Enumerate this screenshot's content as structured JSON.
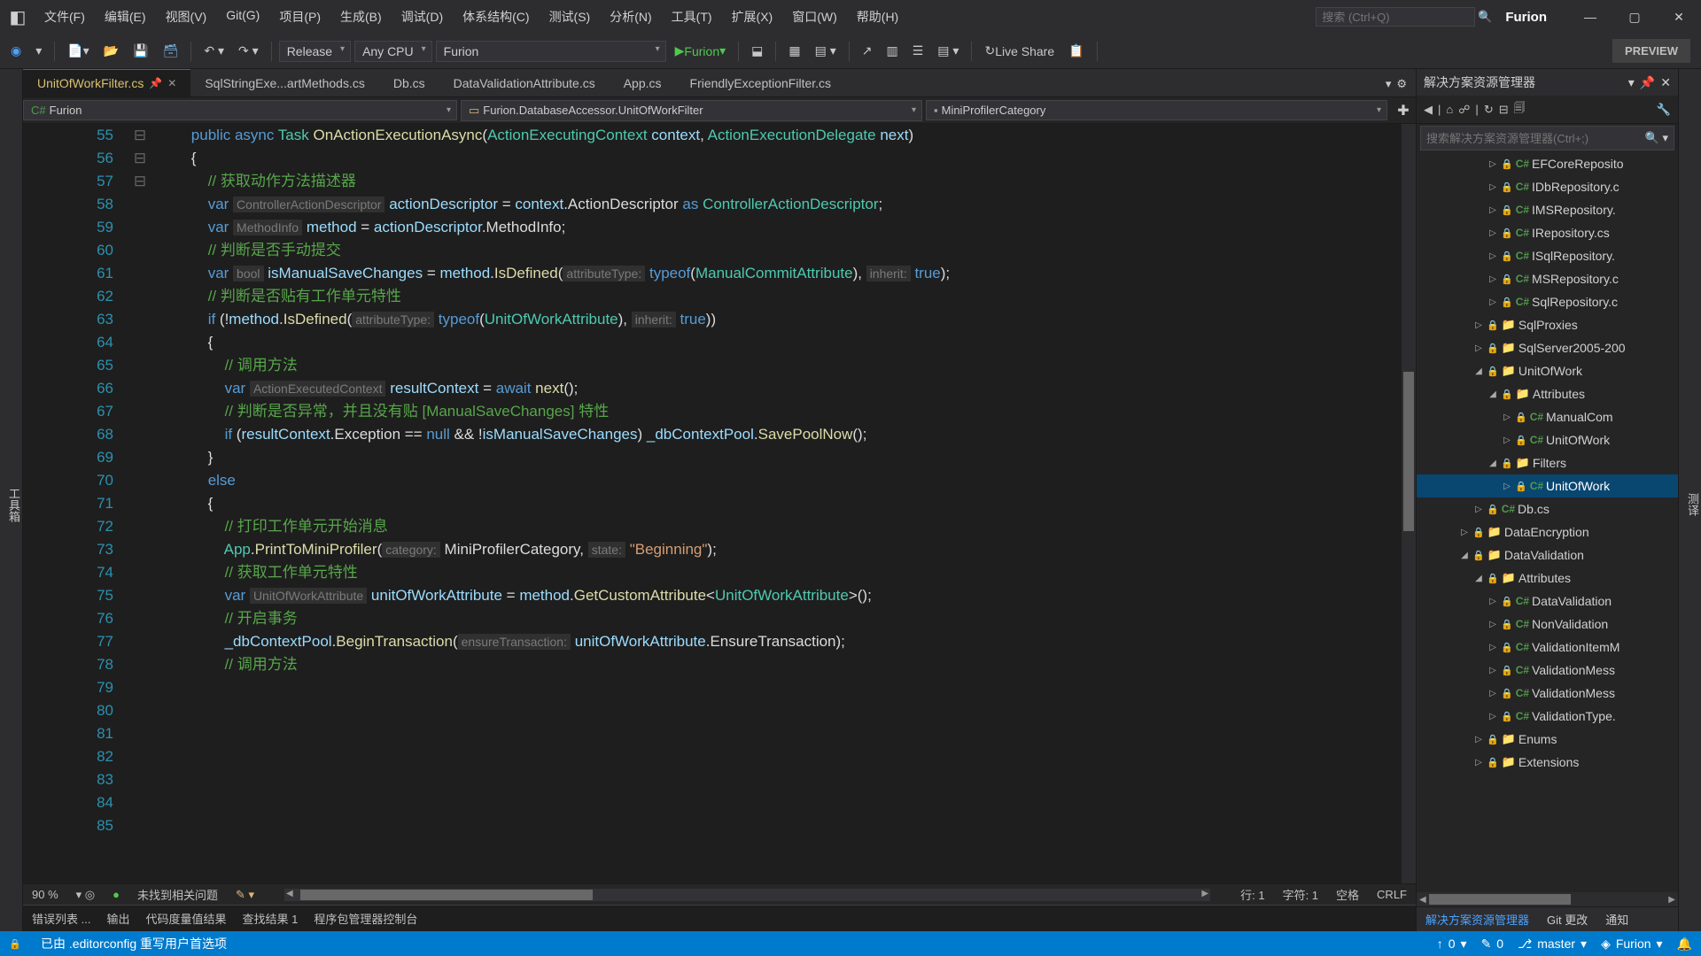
{
  "title": "Furion",
  "menu": [
    "文件(F)",
    "编辑(E)",
    "视图(V)",
    "Git(G)",
    "项目(P)",
    "生成(B)",
    "调试(D)",
    "体系结构(C)",
    "测试(S)",
    "分析(N)",
    "工具(T)",
    "扩展(X)",
    "窗口(W)",
    "帮助(H)"
  ],
  "search_placeholder": "搜索 (Ctrl+Q)",
  "toolbar": {
    "config": "Release",
    "platform": "Any CPU",
    "project": "Furion",
    "run": "Furion",
    "liveshare": "Live Share",
    "preview": "PREVIEW"
  },
  "tabs": [
    "UnitOfWorkFilter.cs",
    "SqlStringExe...artMethods.cs",
    "Db.cs",
    "DataValidationAttribute.cs",
    "App.cs",
    "FriendlyExceptionFilter.cs"
  ],
  "nav": {
    "scope": "Furion",
    "type": "Furion.DatabaseAccessor.UnitOfWorkFilter",
    "member": "MiniProfilerCategory"
  },
  "zoom": "90 %",
  "issues": "未找到相关问题",
  "pos": {
    "line": "行: 1",
    "col": "字符: 1",
    "ws": "空格",
    "eol": "CRLF"
  },
  "bottom": [
    "错误列表 ...",
    "输出",
    "代码度量值结果",
    "查找结果 1",
    "程序包管理器控制台"
  ],
  "status": {
    "text": "已由 .editorconfig 重写用户首选项",
    "up": "0",
    "pen": "0",
    "branch": "master",
    "repo": "Furion"
  },
  "side": {
    "title": "解决方案资源管理器",
    "search_placeholder": "搜索解决方案资源管理器(Ctrl+;)",
    "tabs": [
      "解决方案资源管理器",
      "Git 更改",
      "通知"
    ],
    "tree": [
      {
        "d": 5,
        "t": "cs",
        "a": "▷",
        "n": "EFCoreReposito"
      },
      {
        "d": 5,
        "t": "cs",
        "a": "▷",
        "n": "IDbRepository.c"
      },
      {
        "d": 5,
        "t": "cs",
        "a": "▷",
        "n": "IMSRepository."
      },
      {
        "d": 5,
        "t": "cs",
        "a": "▷",
        "n": "IRepository.cs"
      },
      {
        "d": 5,
        "t": "cs",
        "a": "▷",
        "n": "ISqlRepository."
      },
      {
        "d": 5,
        "t": "cs",
        "a": "▷",
        "n": "MSRepository.c"
      },
      {
        "d": 5,
        "t": "cs",
        "a": "▷",
        "n": "SqlRepository.c"
      },
      {
        "d": 4,
        "t": "fld",
        "a": "▷",
        "n": "SqlProxies"
      },
      {
        "d": 4,
        "t": "fld",
        "a": "▷",
        "n": "SqlServer2005-200"
      },
      {
        "d": 4,
        "t": "fld",
        "a": "▲",
        "n": "UnitOfWork"
      },
      {
        "d": 5,
        "t": "fld",
        "a": "▲",
        "n": "Attributes"
      },
      {
        "d": 6,
        "t": "cs",
        "a": "▷",
        "n": "ManualCom"
      },
      {
        "d": 6,
        "t": "cs",
        "a": "▷",
        "n": "UnitOfWork"
      },
      {
        "d": 5,
        "t": "fld",
        "a": "▲",
        "n": "Filters"
      },
      {
        "d": 6,
        "t": "cs",
        "a": "▷",
        "n": "UnitOfWork",
        "sel": true
      },
      {
        "d": 4,
        "t": "cs",
        "a": "▷",
        "n": "Db.cs"
      },
      {
        "d": 3,
        "t": "fld",
        "a": "▷",
        "n": "DataEncryption"
      },
      {
        "d": 3,
        "t": "fld",
        "a": "▲",
        "n": "DataValidation"
      },
      {
        "d": 4,
        "t": "fld",
        "a": "▲",
        "n": "Attributes"
      },
      {
        "d": 5,
        "t": "cs",
        "a": "▷",
        "n": "DataValidation"
      },
      {
        "d": 5,
        "t": "cs",
        "a": "▷",
        "n": "NonValidation"
      },
      {
        "d": 5,
        "t": "cs",
        "a": "▷",
        "n": "ValidationItemM"
      },
      {
        "d": 5,
        "t": "cs",
        "a": "▷",
        "n": "ValidationMess"
      },
      {
        "d": 5,
        "t": "cs",
        "a": "▷",
        "n": "ValidationMess"
      },
      {
        "d": 5,
        "t": "cs",
        "a": "▷",
        "n": "ValidationType."
      },
      {
        "d": 4,
        "t": "fld",
        "a": "▷",
        "n": "Enums"
      },
      {
        "d": 4,
        "t": "fld",
        "a": "▷",
        "n": "Extensions"
      }
    ]
  },
  "lines": [
    55,
    56,
    57,
    58,
    59,
    60,
    61,
    62,
    63,
    64,
    65,
    66,
    67,
    68,
    69,
    70,
    71,
    72,
    73,
    74,
    75,
    76,
    77,
    78,
    79,
    80,
    81,
    82,
    83,
    84,
    85
  ],
  "code": [
    "",
    "        <span class='k'>public</span> <span class='k'>async</span> <span class='t'>Task</span> <span class='m'>OnActionExecutionAsync</span>(<span class='t'>ActionExecutingContext</span> <span class='v'>context</span>, <span class='t'>ActionExecutionDelegate</span> <span class='v'>next</span>)",
    "        {",
    "            <span class='c'>// 获取动作方法描述器</span>",
    "            <span class='k'>var</span> <span class='hint'>ControllerActionDescriptor</span> <span class='v'>actionDescriptor</span> = <span class='v'>context</span>.ActionDescriptor <span class='k'>as</span> <span class='t'>ControllerActionDescriptor</span>;",
    "            <span class='k'>var</span> <span class='hint'>MethodInfo</span> <span class='v'>method</span> = <span class='v'>actionDescriptor</span>.MethodInfo;",
    "",
    "            <span class='c'>// 判断是否手动提交</span>",
    "            <span class='k'>var</span> <span class='hint'>bool</span> <span class='v'>isManualSaveChanges</span> = <span class='v'>method</span>.<span class='m'>IsDefined</span>(<span class='hint'>attributeType:</span> <span class='k'>typeof</span>(<span class='t'>ManualCommitAttribute</span>), <span class='hint'>inherit:</span> <span class='k'>true</span>);",
    "",
    "            <span class='c'>// 判断是否贴有工作单元特性</span>",
    "            <span class='k'>if</span> (!<span class='v'>method</span>.<span class='m'>IsDefined</span>(<span class='hint'>attributeType:</span> <span class='k'>typeof</span>(<span class='t'>UnitOfWorkAttribute</span>), <span class='hint'>inherit:</span> <span class='k'>true</span>))",
    "            {",
    "                <span class='c'>// 调用方法</span>",
    "                <span class='k'>var</span> <span class='hint'>ActionExecutedContext</span> <span class='v'>resultContext</span> = <span class='k'>await</span> <span class='m'>next</span>();",
    "",
    "                <span class='c'>// 判断是否异常，并且没有贴 [ManualSaveChanges] 特性</span>",
    "                <span class='k'>if</span> (<span class='v'>resultContext</span>.Exception == <span class='k'>null</span> && !<span class='v'>isManualSaveChanges</span>) <span class='v'>_dbContextPool</span>.<span class='m'>SavePoolNow</span>();",
    "            }",
    "            <span class='k'>else</span>",
    "            {",
    "                <span class='c'>// 打印工作单元开始消息</span>",
    "                <span class='t'>App</span>.<span class='m'>PrintToMiniProfiler</span>(<span class='hint'>category:</span> MiniProfilerCategory, <span class='hint'>state:</span> <span class='s'>\"Beginning\"</span>);",
    "",
    "                <span class='c'>// 获取工作单元特性</span>",
    "                <span class='k'>var</span> <span class='hint'>UnitOfWorkAttribute</span> <span class='v'>unitOfWorkAttribute</span> = <span class='v'>method</span>.<span class='m'>GetCustomAttribute</span>&lt;<span class='t'>UnitOfWorkAttribute</span>&gt;();",
    "",
    "                <span class='c'>// 开启事务</span>",
    "                <span class='v'>_dbContextPool</span>.<span class='m'>BeginTransaction</span>(<span class='hint'>ensureTransaction:</span> <span class='v'>unitOfWorkAttribute</span>.EnsureTransaction);",
    "",
    "                <span class='c'>// 调用方法</span>"
  ]
}
